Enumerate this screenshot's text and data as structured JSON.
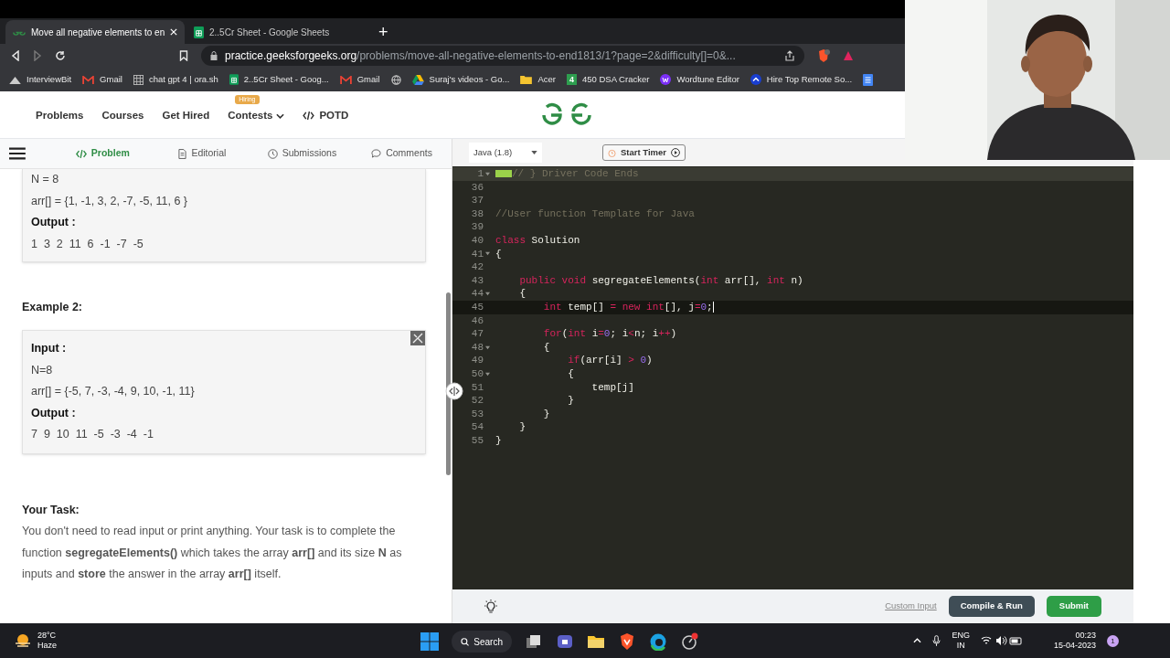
{
  "browser": {
    "tabs": [
      {
        "title": "Move all negative elements to en",
        "selected": true,
        "kind": "gfg"
      },
      {
        "title": "2..5Cr Sheet - Google Sheets",
        "selected": false,
        "kind": "sheets"
      }
    ],
    "new_tab": "+",
    "url_host": "practice.geeksforgeeks.org",
    "url_path": "/problems/move-all-negative-elements-to-end1813/1?page=2&difficulty[]=0&...",
    "bookmarks": [
      {
        "label": "InterviewBit",
        "kind": "mountain"
      },
      {
        "label": "Gmail",
        "kind": "gmail"
      },
      {
        "label": "chat gpt 4 | ora.sh",
        "kind": "grid"
      },
      {
        "label": "2..5Cr Sheet - Goog...",
        "kind": "sheets"
      },
      {
        "label": "Gmail",
        "kind": "gmail"
      },
      {
        "kind": "globe"
      },
      {
        "label": "Suraj's videos - Go...",
        "kind": "drive"
      },
      {
        "label": "Acer",
        "kind": "folder"
      },
      {
        "label": "450 DSA Cracker",
        "kind": "number",
        "icon_text": "4"
      },
      {
        "label": "Wordtune Editor",
        "kind": "wordtune"
      },
      {
        "label": "Hire Top Remote So...",
        "kind": "chevron"
      },
      {
        "kind": "doc"
      }
    ]
  },
  "site_nav": {
    "items": [
      {
        "label": "Problems",
        "kind": "plain"
      },
      {
        "label": "Courses",
        "kind": "plain"
      },
      {
        "label": "Get Hired",
        "kind": "plain"
      },
      {
        "label": "Contests",
        "kind": "dropdown",
        "badge": "Hiring"
      },
      {
        "label": "POTD",
        "kind": "code"
      }
    ]
  },
  "problem_tabs": [
    {
      "label": "Problem",
      "selected": true,
      "kind": "code"
    },
    {
      "label": "Editorial",
      "selected": false,
      "kind": "doc"
    },
    {
      "label": "Submissions",
      "selected": false,
      "kind": "clock"
    },
    {
      "label": "Comments",
      "selected": false,
      "kind": "chat"
    }
  ],
  "example_1": {
    "lines": [
      {
        "text": "N = 8",
        "bold": false
      },
      {
        "text": "arr[] = {1, -1, 3, 2, -7, -5, 11, 6 }",
        "bold": false
      },
      {
        "text": "Output :",
        "bold": true
      },
      {
        "text": "1  3  2  11  6  -1  -7  -5",
        "bold": false
      }
    ]
  },
  "example_2": {
    "heading": "Example 2:",
    "lines": [
      {
        "text": "Input :",
        "bold": true
      },
      {
        "text": "N=8",
        "bold": false
      },
      {
        "text": "arr[] = {-5, 7, -3, -4, 9, 10, -1, 11}",
        "bold": false
      },
      {
        "text": "Output :",
        "bold": true
      },
      {
        "text": "7  9  10  11  -5  -3  -4  -1",
        "bold": false
      }
    ]
  },
  "your_task": {
    "heading": "Your Task:",
    "text": "You don't need to read input or print anything. Your task is to complete the function **segregateElements()** which takes the array **arr[]** and its size **N** as inputs and **store** the answer in the array **arr[]** itself."
  },
  "editor": {
    "language": "Java (1.8)",
    "timer_button": "Start Timer",
    "lines": [
      {
        "num": "1",
        "fold": true,
        "active": false,
        "marker": true,
        "tokens": [
          {
            "kind": "comment",
            "text": "// } Driver Code Ends"
          }
        ]
      },
      {
        "num": "36",
        "fold": false,
        "active": false,
        "marker": false
      },
      {
        "num": "37",
        "fold": false,
        "active": false,
        "marker": false
      },
      {
        "num": "38",
        "fold": false,
        "active": false,
        "marker": false,
        "tokens": [
          {
            "kind": "comment",
            "text": "//User function Template for Java"
          }
        ]
      },
      {
        "num": "39",
        "fold": false,
        "active": false,
        "marker": false
      },
      {
        "num": "40",
        "fold": false,
        "active": false,
        "marker": false,
        "tokens": [
          {
            "kind": "keyword",
            "text": "class"
          },
          {
            "kind": "plain",
            "text": " Solution"
          }
        ]
      },
      {
        "num": "41",
        "fold": true,
        "active": false,
        "marker": false,
        "tokens": [
          {
            "kind": "plain",
            "text": "{"
          }
        ]
      },
      {
        "num": "42",
        "fold": false,
        "active": false,
        "marker": false
      },
      {
        "num": "43",
        "fold": false,
        "active": false,
        "marker": false,
        "tokens": [
          {
            "kind": "keyword",
            "text": "    public"
          },
          {
            "kind": "keyword",
            "text": " void"
          },
          {
            "kind": "plain",
            "text": " segregateElements("
          },
          {
            "kind": "keyword",
            "text": "int"
          },
          {
            "kind": "plain",
            "text": " arr[], "
          },
          {
            "kind": "keyword",
            "text": "int"
          },
          {
            "kind": "plain",
            "text": " n)"
          }
        ]
      },
      {
        "num": "44",
        "fold": true,
        "active": false,
        "marker": false,
        "tokens": [
          {
            "kind": "plain",
            "text": "    {"
          }
        ]
      },
      {
        "num": "45",
        "fold": false,
        "active": true,
        "marker": false,
        "tokens": [
          {
            "kind": "keyword",
            "text": "        int"
          },
          {
            "kind": "plain",
            "text": " temp[] "
          },
          {
            "kind": "operator",
            "text": "="
          },
          {
            "kind": "keyword",
            "text": " new"
          },
          {
            "kind": "keyword",
            "text": " int"
          },
          {
            "kind": "plain",
            "text": "[], j"
          },
          {
            "kind": "operator",
            "text": "="
          },
          {
            "kind": "number",
            "text": "0"
          },
          {
            "kind": "plain",
            "text": ";"
          }
        ]
      },
      {
        "num": "46",
        "fold": false,
        "active": false,
        "marker": false
      },
      {
        "num": "47",
        "fold": false,
        "active": false,
        "marker": false,
        "tokens": [
          {
            "kind": "keyword",
            "text": "        for"
          },
          {
            "kind": "plain",
            "text": "("
          },
          {
            "kind": "keyword",
            "text": "int"
          },
          {
            "kind": "plain",
            "text": " i"
          },
          {
            "kind": "operator",
            "text": "="
          },
          {
            "kind": "number",
            "text": "0"
          },
          {
            "kind": "plain",
            "text": "; i"
          },
          {
            "kind": "operator",
            "text": "<"
          },
          {
            "kind": "plain",
            "text": "n; i"
          },
          {
            "kind": "operator",
            "text": "++"
          },
          {
            "kind": "plain",
            "text": ")"
          }
        ]
      },
      {
        "num": "48",
        "fold": true,
        "active": false,
        "marker": false,
        "tokens": [
          {
            "kind": "plain",
            "text": "        {"
          }
        ]
      },
      {
        "num": "49",
        "fold": false,
        "active": false,
        "marker": false,
        "tokens": [
          {
            "kind": "keyword",
            "text": "            if"
          },
          {
            "kind": "plain",
            "text": "(arr[i] "
          },
          {
            "kind": "operator",
            "text": ">"
          },
          {
            "kind": "number",
            "text": " 0"
          },
          {
            "kind": "plain",
            "text": ")"
          }
        ]
      },
      {
        "num": "50",
        "fold": true,
        "active": false,
        "marker": false,
        "tokens": [
          {
            "kind": "plain",
            "text": "            {"
          }
        ]
      },
      {
        "num": "51",
        "fold": false,
        "active": false,
        "marker": false,
        "tokens": [
          {
            "kind": "plain",
            "text": "                temp[j]"
          }
        ]
      },
      {
        "num": "52",
        "fold": false,
        "active": false,
        "marker": false,
        "tokens": [
          {
            "kind": "plain",
            "text": "            }"
          }
        ]
      },
      {
        "num": "53",
        "fold": false,
        "active": false,
        "marker": false,
        "tokens": [
          {
            "kind": "plain",
            "text": "        }"
          }
        ]
      },
      {
        "num": "54",
        "fold": false,
        "active": false,
        "marker": false,
        "tokens": [
          {
            "kind": "plain",
            "text": "    }"
          }
        ]
      },
      {
        "num": "55",
        "fold": false,
        "active": false,
        "marker": false,
        "tokens": [
          {
            "kind": "plain",
            "text": "}"
          }
        ]
      }
    ],
    "custom_input": "Custom Input",
    "compile_button": "Compile & Run",
    "submit_button": "Submit"
  },
  "taskbar": {
    "weather_temp": "28°C",
    "weather_text": "Haze",
    "search": "Search",
    "lang": "ENG",
    "region": "IN",
    "time": "00:23",
    "date": "15-04-2023",
    "notifications": "1"
  }
}
